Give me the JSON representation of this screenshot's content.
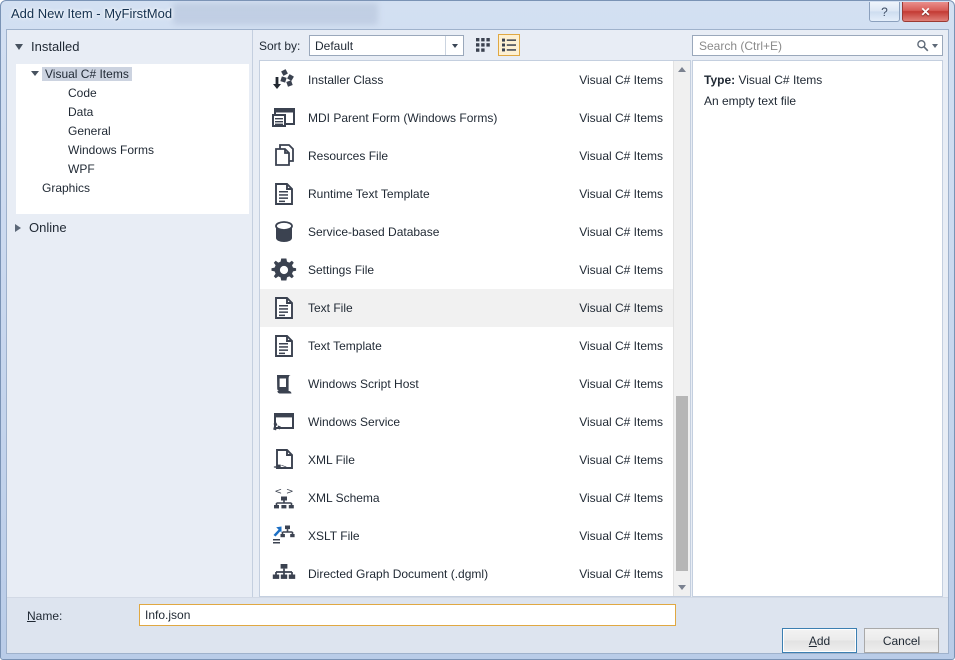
{
  "window": {
    "title": "Add New Item - MyFirstMod",
    "help_button": "?",
    "close_button": "✕"
  },
  "sidebar": {
    "installed_header": "Installed",
    "online_header": "Online",
    "tree": [
      {
        "label": "Visual C# Items",
        "level": 0,
        "expanded": true,
        "selected": true
      },
      {
        "label": "Code",
        "level": 1,
        "expanded": false,
        "selected": false
      },
      {
        "label": "Data",
        "level": 1,
        "expanded": false,
        "selected": false
      },
      {
        "label": "General",
        "level": 1,
        "expanded": false,
        "selected": false
      },
      {
        "label": "Windows Forms",
        "level": 1,
        "expanded": false,
        "selected": false
      },
      {
        "label": "WPF",
        "level": 1,
        "expanded": false,
        "selected": false
      },
      {
        "label": "Graphics",
        "level": 0,
        "expanded": false,
        "selected": false
      }
    ]
  },
  "toolbar": {
    "sort_by_label": "Sort by:",
    "sort_by_value": "Default",
    "sort_by_options": [
      "Default"
    ],
    "view_grid_name": "medium-icons-view",
    "view_list_name": "details-view"
  },
  "search": {
    "placeholder": "Search (Ctrl+E)",
    "value": ""
  },
  "list": {
    "meta_column": "Visual C# Items",
    "items": [
      {
        "label": "Installer Class",
        "meta": "Visual C# Items",
        "icon": "installer-class-icon",
        "selected": false
      },
      {
        "label": "MDI Parent Form (Windows Forms)",
        "meta": "Visual C# Items",
        "icon": "mdi-parent-form-icon",
        "selected": false
      },
      {
        "label": "Resources File",
        "meta": "Visual C# Items",
        "icon": "resources-file-icon",
        "selected": false
      },
      {
        "label": "Runtime Text Template",
        "meta": "Visual C# Items",
        "icon": "runtime-text-template-icon",
        "selected": false
      },
      {
        "label": "Service-based Database",
        "meta": "Visual C# Items",
        "icon": "database-icon",
        "selected": false
      },
      {
        "label": "Settings File",
        "meta": "Visual C# Items",
        "icon": "settings-gear-icon",
        "selected": false
      },
      {
        "label": "Text File",
        "meta": "Visual C# Items",
        "icon": "text-file-icon",
        "selected": true
      },
      {
        "label": "Text Template",
        "meta": "Visual C# Items",
        "icon": "text-template-icon",
        "selected": false
      },
      {
        "label": "Windows Script Host",
        "meta": "Visual C# Items",
        "icon": "windows-script-host-icon",
        "selected": false
      },
      {
        "label": "Windows Service",
        "meta": "Visual C# Items",
        "icon": "windows-service-icon",
        "selected": false
      },
      {
        "label": "XML File",
        "meta": "Visual C# Items",
        "icon": "xml-file-icon",
        "selected": false
      },
      {
        "label": "XML Schema",
        "meta": "Visual C# Items",
        "icon": "xml-schema-icon",
        "selected": false
      },
      {
        "label": "XSLT File",
        "meta": "Visual C# Items",
        "icon": "xslt-file-icon",
        "selected": false
      },
      {
        "label": "Directed Graph Document (.dgml)",
        "meta": "Visual C# Items",
        "icon": "directed-graph-icon",
        "selected": false
      }
    ]
  },
  "details": {
    "type_label": "Type:",
    "type_value": "Visual C# Items",
    "description": "An empty text file"
  },
  "footer": {
    "name_label_prefix": "",
    "name_label_key": "N",
    "name_label_suffix": "ame:",
    "name_value": "Info.json",
    "add_button_key": "A",
    "add_button_suffix": "dd",
    "cancel_button": "Cancel"
  },
  "colors": {
    "selection_highlight": "#f1f1f1",
    "tree_selection": "#ccd3e0",
    "focus_orange": "#e0a842",
    "default_button_blue": "#3c7fb1",
    "close_red": "#c33a33",
    "accent_blue_icon": "#1c6fc4"
  }
}
